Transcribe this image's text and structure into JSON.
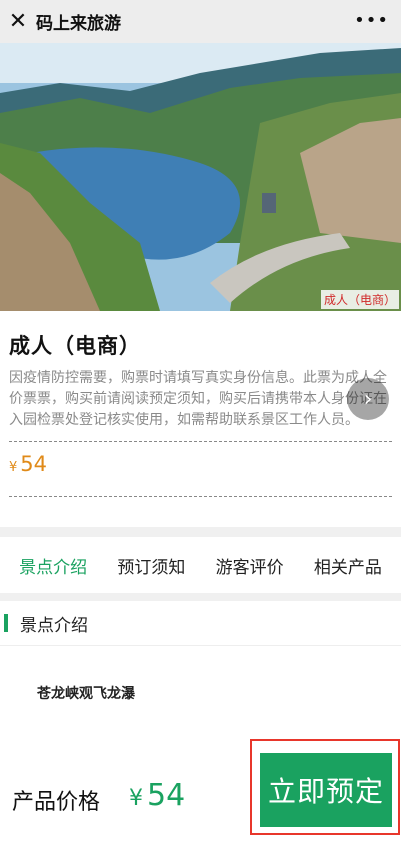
{
  "header": {
    "close_icon": "close-icon",
    "title": "码上来旅游",
    "more_icon": "more-icon"
  },
  "hero": {
    "tag": "成人（电商）"
  },
  "product": {
    "name": "成人（电商）",
    "description": "因疫情防控需要，购票时请填写真实身份信息。此票为成人全价票票，购买前请阅读预定须知，购买后请携带本人身份证在入园检票处登记核实使用，如需帮助联系景区工作人员。",
    "currency": "¥",
    "price": "54"
  },
  "tabs": [
    {
      "label": "景点介绍",
      "active": true
    },
    {
      "label": "预订须知",
      "active": false
    },
    {
      "label": "游客评价",
      "active": false
    },
    {
      "label": "相关产品",
      "active": false
    }
  ],
  "section": {
    "title": "景点介绍",
    "subtitle": "苍龙峡观飞龙瀑"
  },
  "footer": {
    "price_label": "产品价格",
    "currency": "¥",
    "price": "54",
    "book_label": "立即预定"
  },
  "colors": {
    "accent": "#1aa260",
    "price": "#e08a18",
    "highlight_border": "#e8362b"
  }
}
